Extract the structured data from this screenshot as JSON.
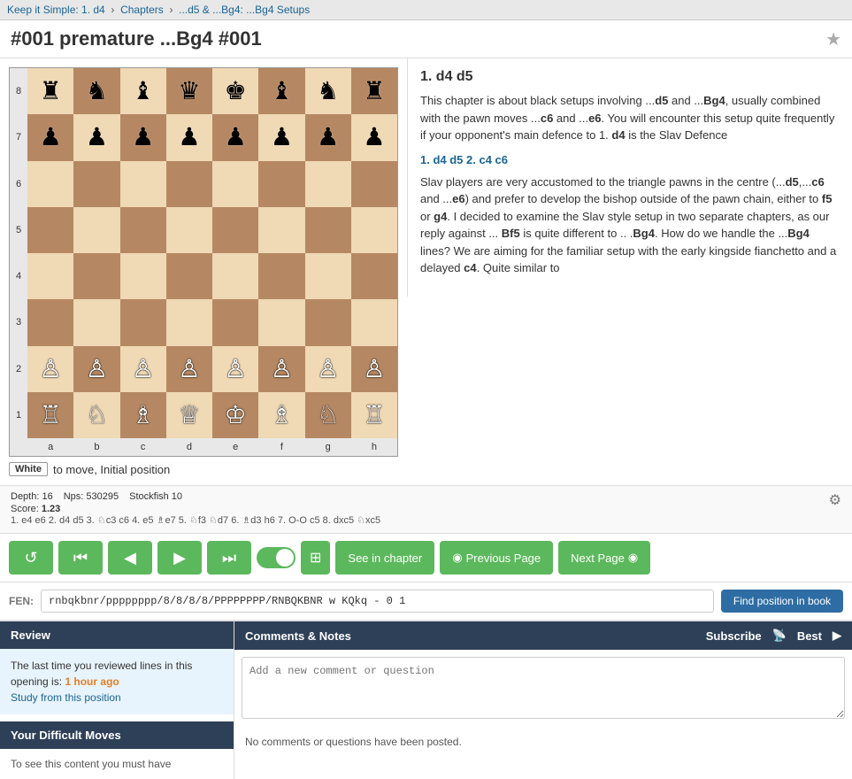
{
  "breadcrumb": {
    "parts": [
      {
        "label": "Keep it Simple: 1. d4",
        "href": "#"
      },
      {
        "label": "Chapters",
        "href": "#"
      },
      {
        "label": "...d5 & ...Bg4: ...Bg4 Setups",
        "href": "#"
      }
    ]
  },
  "page": {
    "title": "#001 premature ...Bg4 #001",
    "bookmark_icon": "★"
  },
  "text_panel": {
    "move_header": "1. d4  d5",
    "paragraphs": [
      "This chapter is about black setups involving ...d5 and ...Bg4, usually combined with the pawn moves ...c6 and ...e6. You will encounter this setup quite frequently if your opponent's main defence to 1. d4 is the Slav Defence",
      "Slav players are very accustomed to the triangle pawns in the centre (...d5,...c6 and ...e6) and prefer to develop the bishop outside of the pawn chain, either to f5 or g4. I decided to examine the Slav style setup in two separate chapters, as our reply against ... Bf5 is quite different to .. .Bg4. How do we handle the ...Bg4 lines? We are aiming for the familiar setup with the early kingside fianchetto and a delayed c4. Quite similar to"
    ],
    "move_line": "1. d4 d5 2. c4 c6"
  },
  "engine": {
    "depth": "16",
    "nps": "530295",
    "name": "Stockfish 10",
    "score_label": "Score:",
    "score": "1.23",
    "line": "1. e4 e6 2. d4 d5 3. ♘c3 c6 4. e5 ♗e7 5. ♘f3 ♘d7 6. ♗d3 h6 7. O-O c5 8. dxc5 ♘xc5"
  },
  "board": {
    "status_white": "White",
    "status_text": "to move, Initial position"
  },
  "controls": {
    "restart_icon": "↺",
    "first_icon": "⏮",
    "prev_icon": "◀",
    "next_icon": "▶",
    "last_icon": "⏭",
    "board_icon": "⊞",
    "see_in_chapter": "See in chapter",
    "previous_page": "Previous Page",
    "next_page": "Next Page"
  },
  "fen": {
    "label": "FEN:",
    "value": "rnbqkbnr/pppppppp/8/8/8/8/PPPPPPPP/RNBQKBNR w KQkq - 0 1",
    "find_button": "Find position in book"
  },
  "review": {
    "header": "Review",
    "content": "The last time you reviewed lines in this opening is:",
    "time": "1 hour ago",
    "study_link": "Study from this position",
    "difficult_header": "Your Difficult Moves",
    "difficult_content": "To see this content you must have"
  },
  "comments": {
    "header": "Comments & Notes",
    "subscribe": "Subscribe",
    "best": "Best",
    "placeholder": "Add a new comment or question",
    "no_comments": "No comments or questions have been posted."
  }
}
